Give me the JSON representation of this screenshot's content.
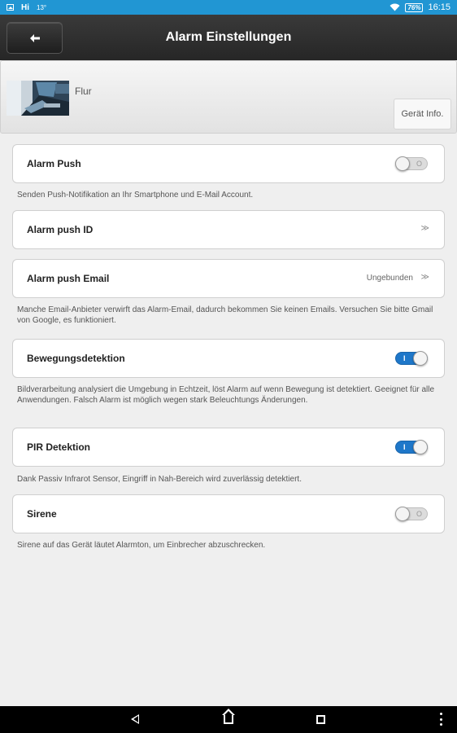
{
  "status_bar": {
    "carrier": "Hi",
    "temperature": "13°",
    "battery": "76%",
    "time": "16:15",
    "icons": [
      "image-icon",
      "wifi-icon",
      "battery-icon"
    ]
  },
  "header": {
    "title": "Alarm Einstellungen",
    "back_icon": "back-arrow-icon"
  },
  "device": {
    "name": "Flur",
    "info_button": "Gerät Info."
  },
  "settings": {
    "alarm_push": {
      "label": "Alarm Push",
      "enabled": false,
      "toggle_text": "O",
      "description": "Senden Push-Notifikation an Ihr Smartphone und E-Mail Account."
    },
    "alarm_push_id": {
      "label": "Alarm push ID",
      "chevron": "≫"
    },
    "alarm_push_email": {
      "label": "Alarm push Email",
      "value": "Ungebunden",
      "chevron": "≫",
      "description": "Manche Email-Anbieter verwirft das Alarm-Email, dadurch bekommen Sie keinen Emails. Versuchen Sie bitte Gmail von Google, es funktioniert."
    },
    "motion_detection": {
      "label": "Bewegungsdetektion",
      "enabled": true,
      "toggle_text": "I",
      "description": "Bildverarbeitung analysiert die Umgebung in Echtzeit, löst Alarm auf wenn Bewegung ist detektiert. Geeignet für alle Anwendungen. Falsch Alarm ist möglich wegen stark Beleuchtungs Änderungen."
    },
    "pir_detection": {
      "label": "PIR Detektion",
      "enabled": true,
      "toggle_text": "I",
      "description": "Dank Passiv Infrarot Sensor, Eingriff in Nah-Bereich wird zuverlässig detektiert."
    },
    "siren": {
      "label": "Sirene",
      "enabled": false,
      "toggle_text": "O",
      "description": "Sirene auf das Gerät läutet Alarmton, um Einbrecher abzuschrecken."
    }
  },
  "colors": {
    "status_bar": "#2196d3",
    "toggle_on": "#1e77c9",
    "toggle_off": "#dcdcdc",
    "title_bar": "#2d2d2d",
    "background": "#efefef"
  },
  "nav_bar": {
    "icons": [
      "nav-back-icon",
      "nav-home-icon",
      "nav-recent-apps-icon",
      "nav-menu-icon"
    ]
  }
}
